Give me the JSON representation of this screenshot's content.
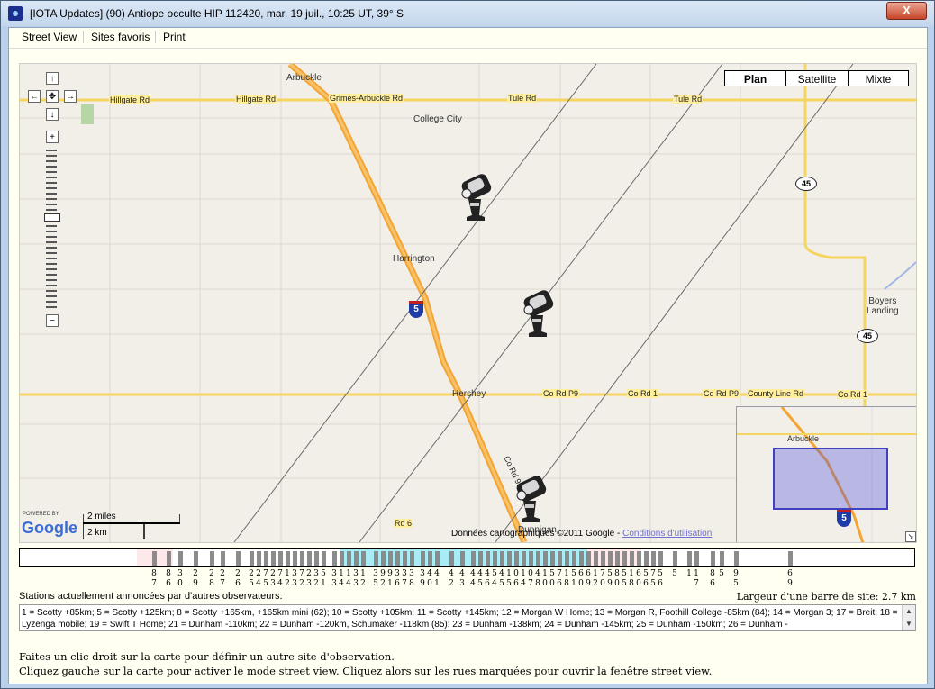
{
  "window": {
    "title": "[IOTA Updates] (90) Antiope occulte HIP 112420, mar. 19 juil., 10:25 UT, 39° S",
    "close_label": "X"
  },
  "menu": {
    "items": [
      "Street View",
      "Sites favoris",
      "Print"
    ]
  },
  "map": {
    "map_types": [
      "Plan",
      "Satellite",
      "Mixte"
    ],
    "active_map_type": "Plan",
    "nav": {
      "up": "↑",
      "down": "↓",
      "left": "←",
      "right": "→",
      "center": "✥",
      "zoom_in": "+",
      "zoom_out": "−"
    },
    "places": {
      "arbuckle": "Arbuckle",
      "college_city": "College City",
      "harrington": "Harrington",
      "hershey": "Hershey",
      "boyers_landing": "Boyers\nLanding",
      "dunnigan": "Dunnigan"
    },
    "roads": {
      "hillgate_rd_1": "Hillgate Rd",
      "hillgate_rd_2": "Hillgate Rd",
      "grimes_arbuckle_rd": "Grimes-Arbuckle Rd",
      "tule_rd_1": "Tule Rd",
      "tule_rd_2": "Tule Rd",
      "co_rd_p9_1": "Co Rd P9",
      "co_rd_1_a": "Co Rd 1",
      "co_rd_p9_2": "Co Rd P9",
      "county_line_rd": "County Line Rd",
      "co_rd_1_b": "Co Rd 1",
      "co_rd_99": "Co Rd 99",
      "rd_6": "Rd 6"
    },
    "shields": {
      "hwy45_a": "45",
      "hwy45_b": "45",
      "i5_a": "5",
      "i5_b": "5"
    },
    "overview_label": "Arbuckle",
    "overview_shield": "5",
    "powered_by": "POWERED BY",
    "google": "Google",
    "scale_miles": "2 miles",
    "scale_km": "2 km",
    "copyright": "Données cartographiques ©2011 Google - ",
    "terms_link": "Conditions d'utilisation"
  },
  "sitebar": {
    "numbers": [
      "8\n7",
      "8\n6",
      "3\n0",
      "2\n9",
      "2\n8",
      "2\n7",
      "2\n6",
      "2\n5",
      "2\n4",
      "7\n5",
      "2\n3",
      "7\n4",
      "1\n2",
      "3\n3",
      "7\n2",
      "2\n3",
      "3\n2",
      "5\n1",
      "3\n3",
      "1\n4",
      "1\n4",
      "3\n3",
      "1\n2",
      "3\n5",
      "9\n2",
      "9\n1",
      "3\n6",
      "3\n7",
      "3\n8",
      "3\n9",
      "4\n0",
      "4\n1",
      "4\n2",
      "4\n3",
      "4\n4",
      "4\n5",
      "4\n6",
      "5\n4",
      "4\n5",
      "1\n5",
      "0\n6",
      "1\n4",
      "0\n7",
      "4\n8",
      "1\n0",
      "5\n0",
      "7\n6",
      "1\n8",
      "5\n1",
      "6\n0",
      "6\n9",
      "1\n2",
      "7\n0",
      "5\n9",
      "8\n0",
      "5\n5",
      "1\n8",
      "6\n0",
      "5\n6",
      "7\n5",
      "5\n6",
      "5",
      "1",
      "1\n7",
      "8\n6",
      "5",
      "9\n5",
      "6\n9"
    ],
    "bar_width_label": "Largeur d'une barre de site: 2.7 km"
  },
  "stations": {
    "label": "Stations actuellement annoncées par d'autres observateurs:",
    "text": "1 = Scotty +85km; 5 = Scotty +125km; 8 = Scotty +165km, +165km mini (62); 10 = Scotty +105km; 11 = Scotty +145km; 12 = Morgan W Home; 13 = Morgan R, Foothill College -85km (84); 14 = Morgan 3; 17 = Breit; 18 = Lyzenga mobile; 19 = Swift T Home; 21 = Dunham -110km; 22 = Dunham -120km, Schumaker -118km (85); 23 = Dunham -138km; 24 = Dunham -145km; 25 = Dunham -150km; 26 = Dunham -"
  },
  "help": {
    "line1": "Faites un clic droit sur la carte pour définir un autre site d'observation.",
    "line2": "Cliquez gauche sur la carte pour activer le mode street view. Cliquez alors sur les rues marquées pour ouvrir la fenêtre street view."
  }
}
